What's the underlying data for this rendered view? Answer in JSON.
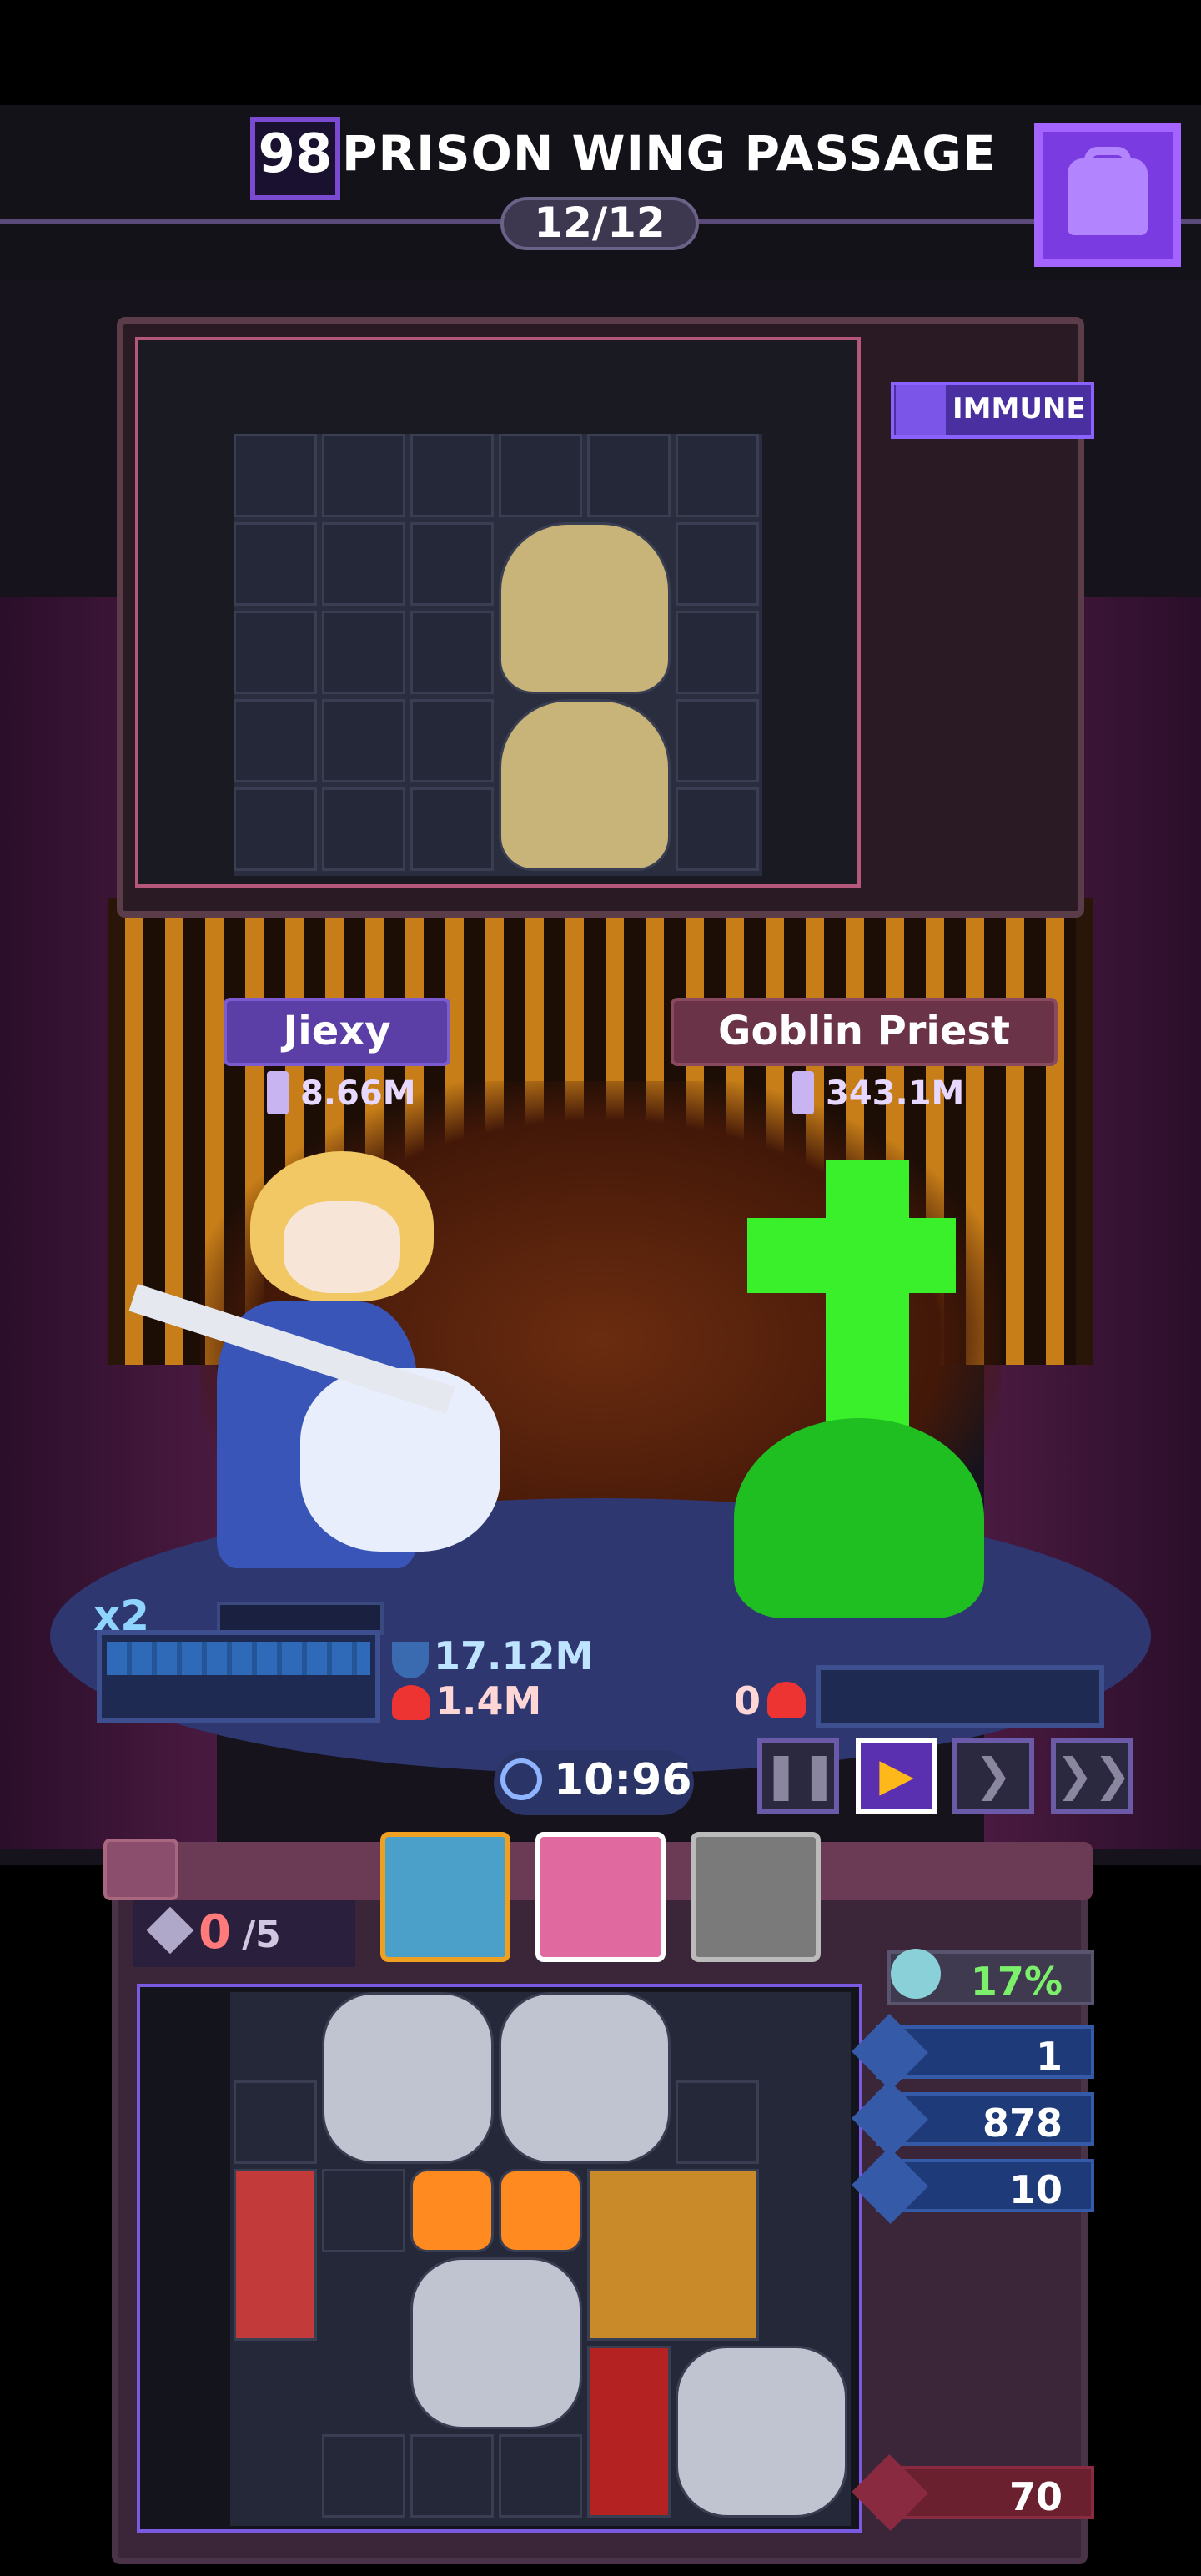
{
  "header": {
    "level": "98",
    "zone_title": "PRISON WING PASSAGE",
    "wave": "12/12",
    "inventory_icon": "backpack-icon"
  },
  "enemy_status": {
    "badge": "IMMUNE"
  },
  "combatants": {
    "hero": {
      "name": "Jiexy",
      "attack": "8.66M",
      "shield": "17.12M",
      "hp": "1.4M",
      "multiplier": "x2"
    },
    "enemy": {
      "name": "Goblin Priest",
      "attack": "343.1M",
      "hp": "0"
    }
  },
  "battle": {
    "timer": "10:96",
    "speed": {
      "pause_glyph": "❚❚",
      "play_glyph": "▶",
      "fast_glyph": "❯",
      "faster_glyph": "❯❯",
      "selected": "play"
    }
  },
  "backpack": {
    "slots_used": "0",
    "slots_total": "/5",
    "stats": {
      "crit": "17%",
      "stat_1": "1",
      "stat_2": "878",
      "stat_3": "10",
      "stat_4": "70"
    }
  },
  "colors": {
    "accent": "#7a3ce0",
    "hero_plate": "#5b3fa6",
    "enemy_plate": "#6b3348",
    "enemy_green": "#3af02a"
  }
}
